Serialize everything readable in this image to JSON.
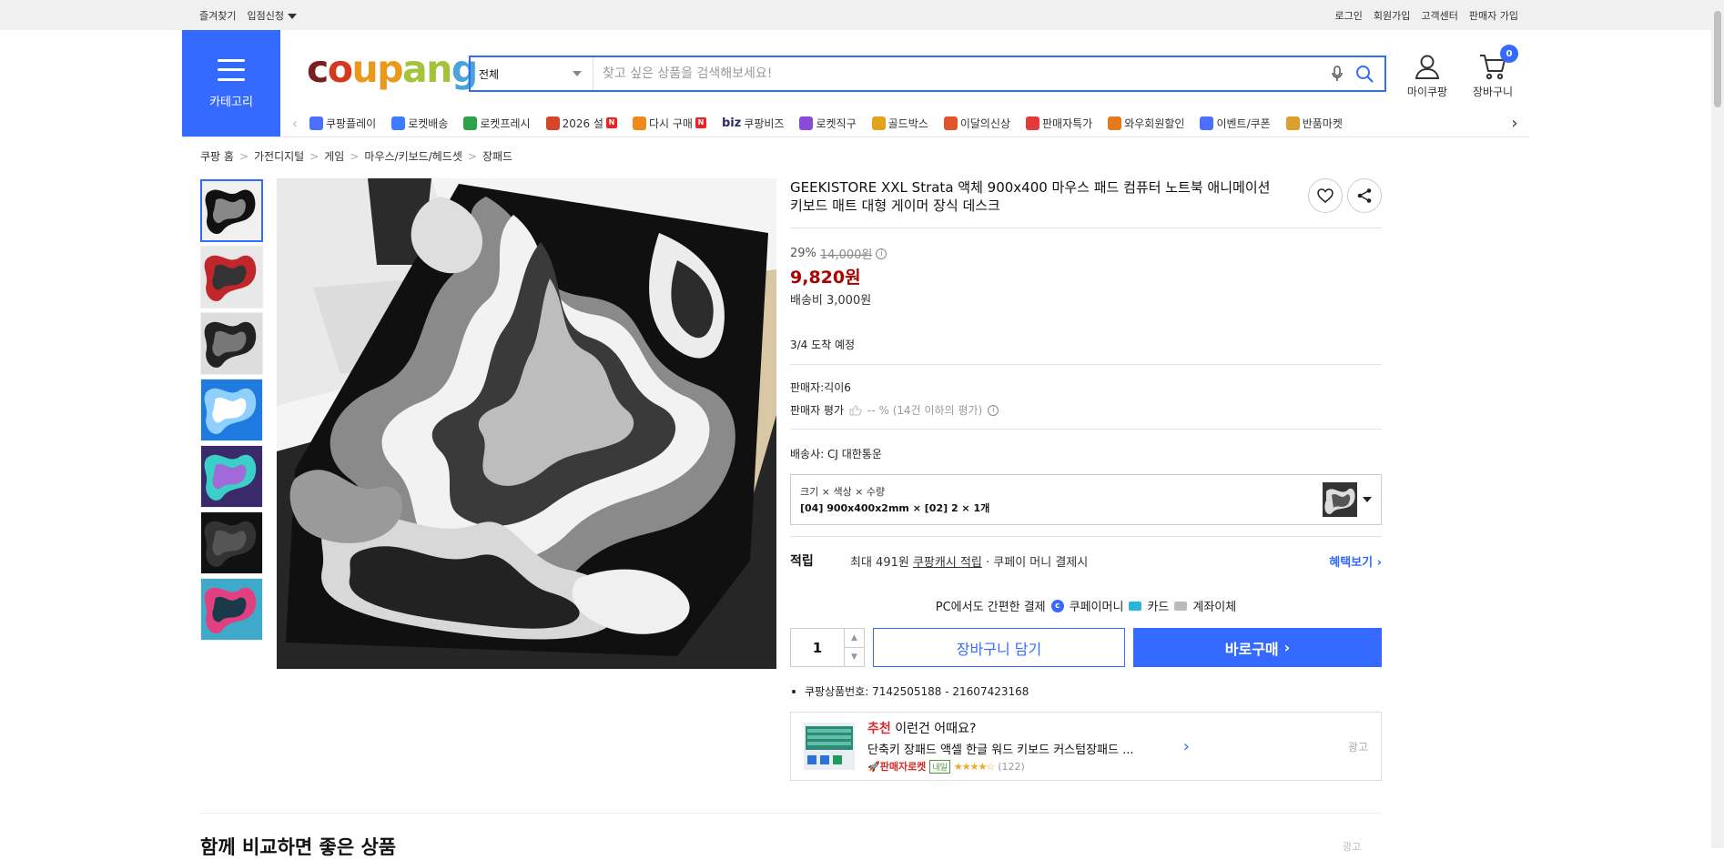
{
  "topbar": {
    "left": [
      "즐겨찾기",
      "입점신청"
    ],
    "right": [
      "로그인",
      "회원가입",
      "고객센터",
      "판매자 가입"
    ]
  },
  "header": {
    "category_label": "카테고리",
    "logo": [
      "c",
      "o",
      "u",
      "p",
      "a",
      "n",
      "g"
    ],
    "search_category": "전체",
    "search_placeholder": "찾고 싶은 상품을 검색해보세요!",
    "my_coupang": "마이쿠팡",
    "cart": "장바구니",
    "cart_count": "0"
  },
  "nav": {
    "items": [
      {
        "label": "쿠팡플레이",
        "color": "#4b6fff"
      },
      {
        "label": "로켓배송",
        "color": "#3d7bff"
      },
      {
        "label": "로켓프레시",
        "color": "#2ca24c"
      },
      {
        "label": "2026 설",
        "color": "#d8452a",
        "badge": "N"
      },
      {
        "label": "다시 구매",
        "color": "#f08a1c",
        "badge": "N"
      },
      {
        "label": "쿠팡비즈",
        "prefix": "biz"
      },
      {
        "label": "로켓직구",
        "color": "#8a4bd8"
      },
      {
        "label": "골드박스",
        "color": "#e3a31c"
      },
      {
        "label": "이달의신상",
        "color": "#e0562a"
      },
      {
        "label": "판매자특가",
        "color": "#e23a3a"
      },
      {
        "label": "와우회원할인",
        "color": "#e27b1c"
      },
      {
        "label": "이벤트/쿠폰",
        "color": "#4b6fff"
      },
      {
        "label": "반품마켓",
        "color": "#d9a12b"
      }
    ]
  },
  "breadcrumb": [
    "쿠팡 홈",
    "가전디지털",
    "게임",
    "마우스/키보드/헤드셋",
    "장패드"
  ],
  "product": {
    "title": "GEEKISTORE XXL Strata 액체 900x400 마우스 패드 컴퓨터 노트북 애니메이션 키보드 매트 대형 게이머 장식 데스크",
    "discount_rate": "29%",
    "original_price": "14,000원",
    "price": "9,820원",
    "shipping_fee": "배송비 3,000원",
    "arrival": "3/4 도착 예정",
    "seller": "판매자:긱이6",
    "seller_rating_label": "판매자 평가",
    "seller_rating_value": "-- % (14건 이하의 평가)",
    "carrier": "배송사:  CJ 대한통운",
    "option_label": "크기 × 색상 × 수량",
    "option_value": "[04] 900x400x2mm × [02] 2 × 1개",
    "reward_label": "적립",
    "reward_prefix": "최대 491원 ",
    "reward_link": "쿠팡캐시 적립",
    "reward_suffix": " · 쿠페이 머니 결제시",
    "benefit": "혜택보기",
    "pay_prefix": "PC에서도 간편한 결제",
    "pay_methods": [
      "쿠페이머니",
      "카드",
      "계좌이체"
    ],
    "quantity": "1",
    "cart_button": "장바구니 담기",
    "buy_button": "바로구매",
    "product_number": "쿠팡상품번호: 7142505188 - 21607423168"
  },
  "thumbnails": [
    {
      "a": "#f0f0f0",
      "b": "#111",
      "c": "#888"
    },
    {
      "a": "#e8e8e8",
      "b": "#c0262a",
      "c": "#333"
    },
    {
      "a": "#ddd",
      "b": "#222",
      "c": "#777"
    },
    {
      "a": "#1f7be0",
      "b": "#8fd0ff",
      "c": "#fff"
    },
    {
      "a": "#3a2a6a",
      "b": "#3ad0c8",
      "c": "#a06ad8"
    },
    {
      "a": "#111",
      "b": "#333",
      "c": "#555"
    },
    {
      "a": "#3fa9c9",
      "b": "#e04080",
      "c": "#1a3a4a"
    }
  ],
  "recommend": {
    "head_red": "추천",
    "head": " 이런건 어때요?",
    "name": "단축키 장패드 액셀 한글 워드 키보드 커스텀장패드 ...",
    "rocket": "판매자로켓",
    "tag": "내일",
    "stars": "★★★★☆",
    "reviews": "(122)",
    "ad": "광고"
  },
  "bottom": {
    "title": "함께 비교하면 좋은 상품",
    "ad": "광고"
  }
}
